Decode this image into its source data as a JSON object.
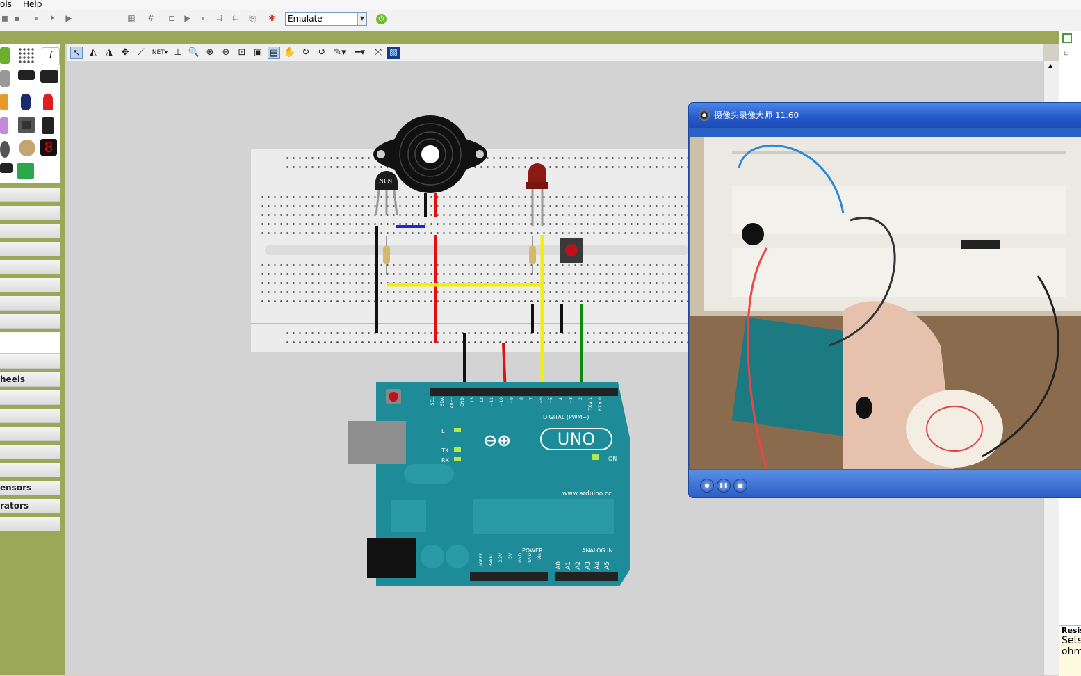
{
  "menu": {
    "tools_partial": "ols",
    "help": "Help"
  },
  "toolbar": {
    "simulation_mode": "Emulate",
    "icons": [
      "reset-icon",
      "stop-icon",
      "pause-icon",
      "step-icon",
      "play-icon",
      "grid-icon",
      "hash-icon",
      "netlist-icon",
      "run-icon",
      "pause-icon",
      "push-icon",
      "pop-icon",
      "export-icon",
      "debug-icon",
      "start-simulation-icon"
    ]
  },
  "parts_panel": {
    "categories": [
      "",
      "",
      "",
      "",
      "",
      "",
      "",
      "",
      "",
      "",
      "heels",
      "",
      "",
      "",
      "",
      "",
      "ensors",
      "rators",
      ""
    ]
  },
  "breadboard": {
    "transistor_label": "NPN"
  },
  "arduino": {
    "board_name": "UNO",
    "header_digital": "DIGITAL (PWM~)",
    "led_l": "L",
    "led_tx": "TX",
    "led_rx": "RX",
    "on_label": "ON",
    "website": "www.arduino.cc",
    "power_label": "POWER",
    "analog_label": "ANALOG IN",
    "analog_pins": [
      "A0",
      "A1",
      "A2",
      "A3",
      "A4",
      "A5"
    ],
    "digital_pins": [
      "SCL",
      "SDA",
      "AREF",
      "GND",
      "13",
      "12",
      "~11",
      "~10",
      "~9",
      "8",
      "7",
      "~6",
      "~5",
      "4",
      "~3",
      "2",
      "TX►1",
      "RX◄0"
    ],
    "power_pins": [
      "IOREF",
      "RESET",
      "3.3V",
      "5V",
      "GND",
      "GND",
      "Vin"
    ]
  },
  "camera_window": {
    "title": "摄像头录像大师  11.60"
  },
  "property_panel": {
    "heading": "Resis",
    "line1": "Sets",
    "line2": "ohm"
  },
  "colors": {
    "frame_green": "#9aa857",
    "arduino_teal": "#1d8c98",
    "xp_blue": "#2b63c5"
  }
}
